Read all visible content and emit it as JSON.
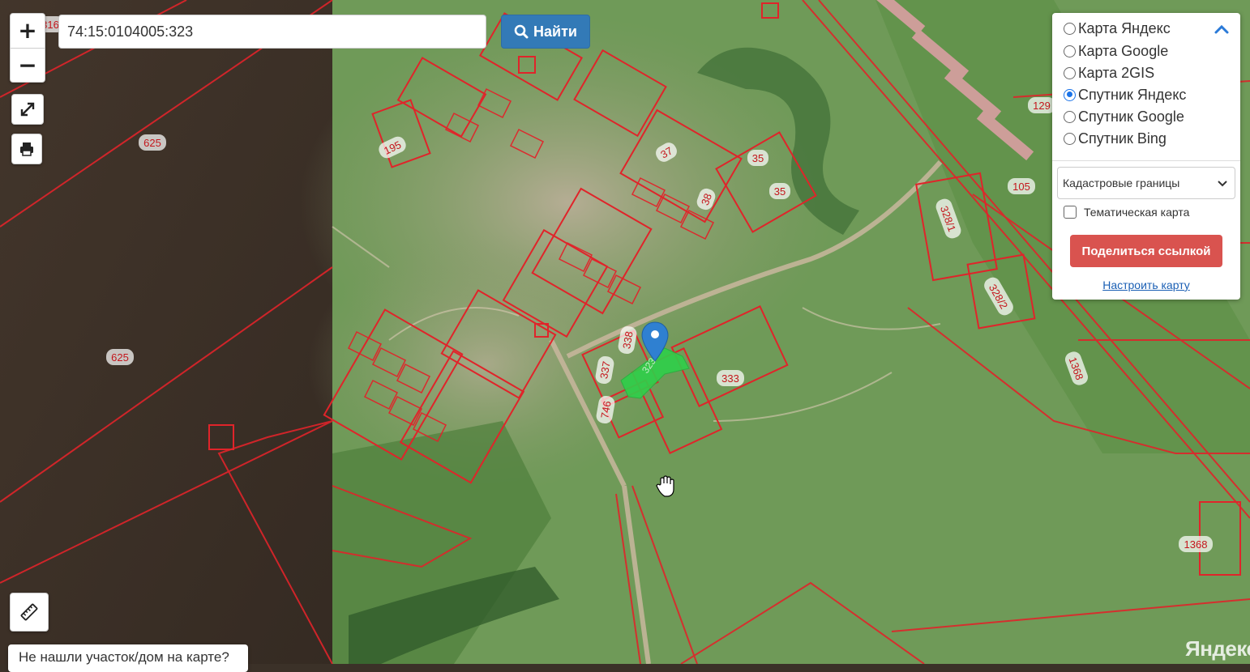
{
  "search": {
    "value": "74:15:0104005:323",
    "button_label": "Найти"
  },
  "zoom": {
    "in_label": "+",
    "out_label": "−"
  },
  "layers": {
    "options": [
      {
        "label": "Карта Яндекс",
        "selected": false
      },
      {
        "label": "Карта Google",
        "selected": false
      },
      {
        "label": "Карта 2GIS",
        "selected": false
      },
      {
        "label": "Спутник Яндекс",
        "selected": true
      },
      {
        "label": "Спутник Google",
        "selected": false
      },
      {
        "label": "Спутник Bing",
        "selected": false
      }
    ],
    "overlay_select": "Кадастровые границы",
    "thematic_label": "Тематическая карта",
    "share_label": "Поделиться ссылкой",
    "settings_label": "Настроить карту"
  },
  "footer": {
    "not_found": "Не нашли участок/дом на карте?"
  },
  "provider": {
    "logo": "Яндекс"
  },
  "parcels": [
    {
      "label": "625"
    },
    {
      "label": "625"
    },
    {
      "label": "195"
    },
    {
      "label": "37"
    },
    {
      "label": "35"
    },
    {
      "label": "35"
    },
    {
      "label": "38"
    },
    {
      "label": "338"
    },
    {
      "label": "337"
    },
    {
      "label": "333"
    },
    {
      "label": "746"
    },
    {
      "label": "328/1"
    },
    {
      "label": "328/2"
    },
    {
      "label": "105"
    },
    {
      "label": "129"
    },
    {
      "label": "1368"
    },
    {
      "label": "1368"
    },
    {
      "label": "316"
    }
  ],
  "selected_parcel": {
    "label": "323",
    "color": "#2fd04a"
  },
  "colors": {
    "boundary": "#e0242a",
    "primary": "#337ab7",
    "danger": "#d9534f",
    "marker": "#2f80d1"
  },
  "icons": [
    "search-icon",
    "fullscreen-icon",
    "print-icon",
    "ruler-icon",
    "chevron-up-icon",
    "chevron-down-icon",
    "map-pin-icon",
    "hand-cursor-icon"
  ]
}
